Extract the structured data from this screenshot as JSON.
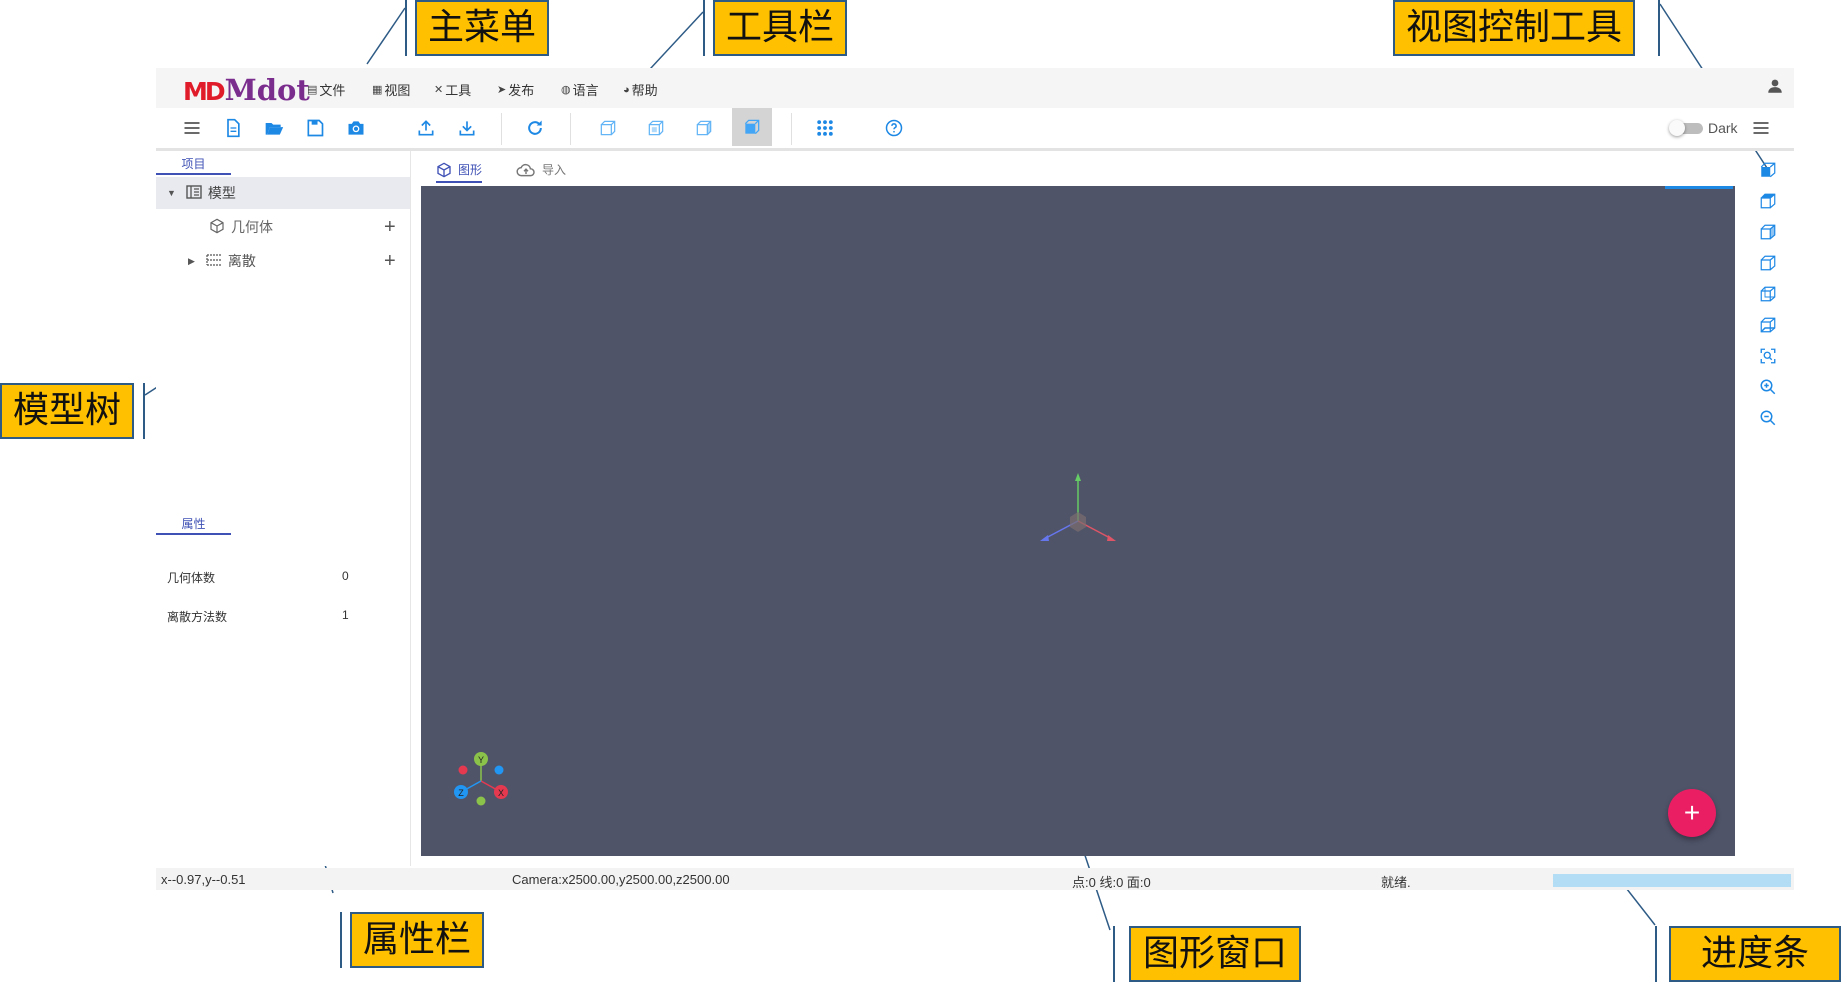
{
  "callouts": {
    "main_menu": "主菜单",
    "toolbar": "工具栏",
    "view_tools": "视图控制工具",
    "model_tree": "模型树",
    "property_panel": "属性栏",
    "graphics_window": "图形窗口",
    "progress_bar": "进度条"
  },
  "app": {
    "logo_mark": "MD",
    "logo_text": "Mdot"
  },
  "menu": {
    "items": [
      {
        "label": "文件",
        "icon": "file-icon"
      },
      {
        "label": "视图",
        "icon": "grid-icon"
      },
      {
        "label": "工具",
        "icon": "tools-icon"
      },
      {
        "label": "发布",
        "icon": "send-icon"
      },
      {
        "label": "语言",
        "icon": "globe-icon"
      },
      {
        "label": "帮助",
        "icon": "help-icon"
      }
    ],
    "user_icon": "user-icon"
  },
  "toolbar": {
    "dark_label": "Dark",
    "dark_enabled": false
  },
  "left_panel": {
    "project_tab": "项目",
    "tree": [
      {
        "label": "模型",
        "icon": "model-icon",
        "expanded": true
      },
      {
        "label": "几何体",
        "icon": "cube-icon"
      },
      {
        "label": "离散",
        "icon": "mesh-icon",
        "expanded": false
      }
    ],
    "property_tab": "属性",
    "properties": [
      {
        "name": "几何体数",
        "value": "0"
      },
      {
        "name": "离散方法数",
        "value": "1"
      }
    ]
  },
  "viewport": {
    "tabs": [
      {
        "label": "图形",
        "icon": "cube-icon",
        "active": true
      },
      {
        "label": "导入",
        "icon": "cloud-upload-icon",
        "active": false
      }
    ],
    "axis_labels": {
      "x": "X",
      "y": "Y",
      "z": "Z"
    },
    "fab_label": "+"
  },
  "status": {
    "coords": "x--0.97,y--0.51",
    "camera": "Camera:x2500.00,y2500.00,z2500.00",
    "counts": "点:0 线:0 面:0",
    "state": "就绪."
  },
  "colors": {
    "callout_fill": "#ffc000",
    "callout_border": "#2e5b86",
    "accent": "#1e88e5",
    "viewport_bg": "#505469",
    "fab": "#e91e63",
    "progress": "#b3dcf5"
  }
}
